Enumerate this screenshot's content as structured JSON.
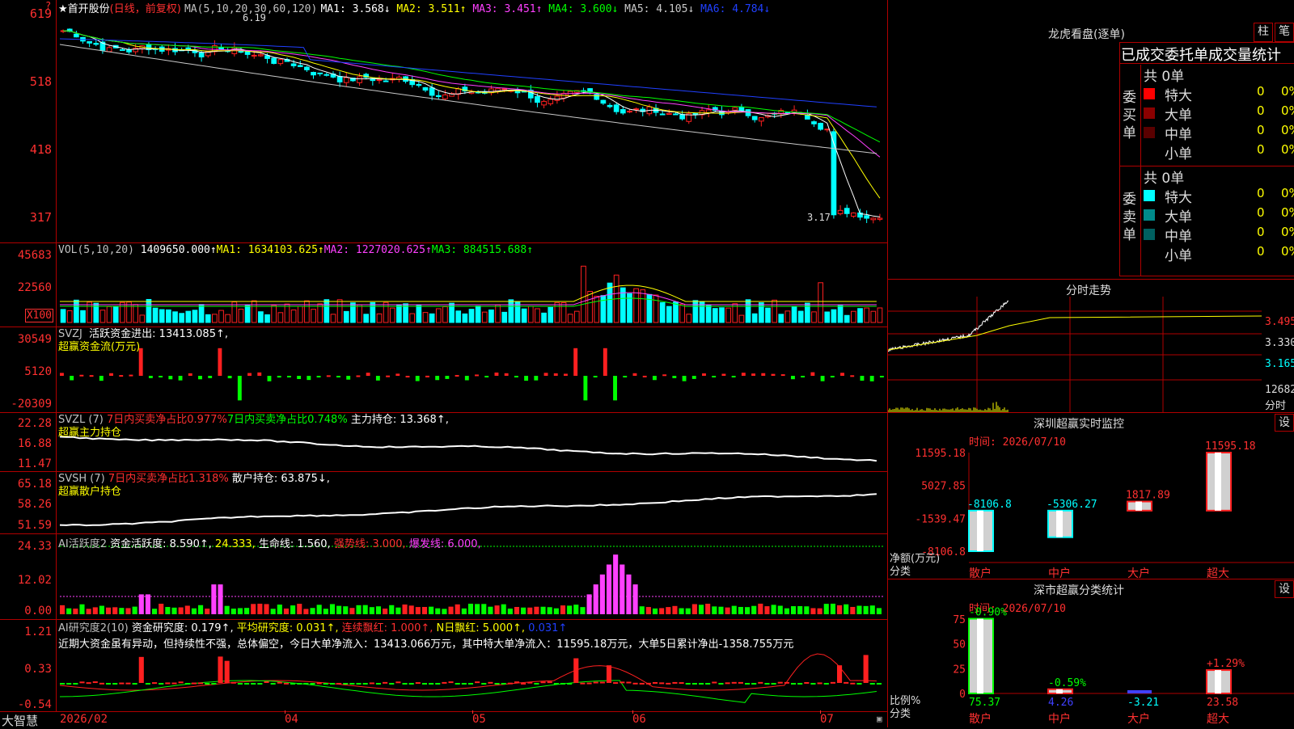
{
  "main": {
    "star": "★",
    "stock": "首开股份",
    "period": "(日线，前复权)",
    "ma_params": "MA(5,10,20,30,60,120)",
    "ma": [
      {
        "label": "MA1: 3.568↓",
        "color": "#ffffff"
      },
      {
        "label": "MA2: 3.511↑",
        "color": "#ffff00"
      },
      {
        "label": "MA3: 3.451↑",
        "color": "#ff40ff"
      },
      {
        "label": "MA4: 3.600↓",
        "color": "#00ff00"
      },
      {
        "label": "MA5: 4.105↓",
        "color": "#c8c8c8"
      },
      {
        "label": "MA6: 4.784↓",
        "color": "#2040ff"
      }
    ],
    "y_ticks": [
      "619",
      "518",
      "418",
      "317"
    ],
    "high_note": "6.19",
    "low_note": "3.17"
  },
  "vol": {
    "params": "VOL(5,10,20)",
    "value": "1409650.000↑",
    "ma1": "MA1: 1634103.625↑",
    "ma2": "MA2: 1227020.625↑",
    "ma3": "MA3: 884515.688↑",
    "y_ticks": [
      "45683",
      "22560"
    ],
    "unit": "X100"
  },
  "svzj": {
    "title": "SVZJ",
    "line": "活跃资金进出: 13413.085↑,",
    "sub": "超赢资金流(万元)",
    "y_ticks": [
      "30549",
      "5120",
      "-20309"
    ]
  },
  "svzl": {
    "title": "SVZL (7)",
    "a": "7日内买卖净占比0.977%",
    "b": "7日内买卖净占比0.748%",
    "c": "主力持仓: 13.368↑,",
    "sub": "超赢主力持仓",
    "y_ticks": [
      "22.28",
      "16.88",
      "11.47"
    ]
  },
  "svsh": {
    "title": "SVSH (7)",
    "a": "7日内买卖净占比1.318%",
    "b": "散户持仓: 63.875↓,",
    "sub": "超赢散户持仓",
    "y_ticks": [
      "65.18",
      "58.26",
      "51.59"
    ]
  },
  "ai1": {
    "title": "AI活跃度2",
    "a": "资金活跃度: 8.590↑,",
    "b": "24.333,",
    "c": "生命线: 1.560,",
    "d": "强势线: 3.000,",
    "e": "爆发线: 6.000,",
    "y_ticks": [
      "24.33",
      "12.02",
      "0.00"
    ]
  },
  "ai2": {
    "title": "AI研究度2(10)",
    "a": "资金研究度: 0.179↑,",
    "b": "平均研究度: 0.031↑,",
    "c": "连续飘红: 1.000↑,",
    "d": "N日飘红: 5.000↑,",
    "e": "0.031↑",
    "comment": "近期大资金虽有异动，但持续性不强，总体偏空，今日大单净流入：13413.066万元，其中特大单净流入：11595.18万元，大单5日累计净出-1358.755万元",
    "y_ticks": [
      "1.21",
      "0.33",
      "-0.54"
    ]
  },
  "xaxis": {
    "brand": "大智慧",
    "labels": [
      "2026/02",
      "04",
      "05",
      "06",
      "07"
    ]
  },
  "lhb": {
    "title": "龙虎看盘(逐单)",
    "btn1": "柱",
    "btn2": "笔",
    "header": "已成交委托单成交量统计",
    "buy_label": "委买单",
    "sell_label": "委卖单",
    "buy_total": "共 0单",
    "sell_total": "共 0单",
    "buy_rows": [
      {
        "name": "特大",
        "n": "0",
        "p": "0%",
        "color": "#ff0000"
      },
      {
        "name": "大单",
        "n": "0",
        "p": "0%",
        "color": "#8b0000"
      },
      {
        "name": "中单",
        "n": "0",
        "p": "0%",
        "color": "#5a0000"
      },
      {
        "name": "小单",
        "n": "0",
        "p": "0%",
        "color": "#000000"
      }
    ],
    "sell_rows": [
      {
        "name": "特大",
        "n": "0",
        "p": "0%",
        "color": "#00ffff"
      },
      {
        "name": "大单",
        "n": "0",
        "p": "0%",
        "color": "#008b8b"
      },
      {
        "name": "中单",
        "n": "0",
        "p": "0%",
        "color": "#006060"
      },
      {
        "name": "小单",
        "n": "0",
        "p": "0%",
        "color": "#000000"
      }
    ]
  },
  "fenshi": {
    "title": "分时走势",
    "y_ticks": [
      "3.495",
      "3.330",
      "3.165"
    ],
    "vol_label": "12682",
    "unit": "分时"
  },
  "sz_monitor": {
    "title": "深圳超赢实时监控",
    "btn": "设",
    "time": "时间: 2026/07/10",
    "y_ticks": [
      "11595.18",
      "5027.85",
      "-1539.47",
      "-8106.8"
    ],
    "y_label": "净额(万元)",
    "x_label": "分类",
    "bars": [
      {
        "cat": "散户",
        "value": -8106.8,
        "label": "-8106.8"
      },
      {
        "cat": "中户",
        "value": -5306.27,
        "label": "-5306.27"
      },
      {
        "cat": "大户",
        "value": 1817.89,
        "label": "1817.89"
      },
      {
        "cat": "超大",
        "value": 11595.18,
        "label": "11595.18"
      }
    ]
  },
  "sz_class": {
    "title": "深市超赢分类统计",
    "btn": "设",
    "time": "时间: 2026/07/10",
    "y_ticks": [
      "75",
      "50",
      "25",
      "0"
    ],
    "y_label": "比例%",
    "x_label": "分类",
    "bars": [
      {
        "cat": "散户",
        "value": 75.37,
        "label": "75.37",
        "pct": "-0.90%"
      },
      {
        "cat": "中户",
        "value": 4.26,
        "label": "4.26",
        "pct": "-0.59%"
      },
      {
        "cat": "大户",
        "value": -3.21,
        "label": "-3.21",
        "pct": ""
      },
      {
        "cat": "超大",
        "value": 23.58,
        "label": "23.58",
        "pct": "+1.29%"
      }
    ]
  },
  "colors": {
    "up": "#ff2020",
    "down": "#00ffff",
    "red_grid": "#b00000",
    "green": "#00ff00"
  }
}
